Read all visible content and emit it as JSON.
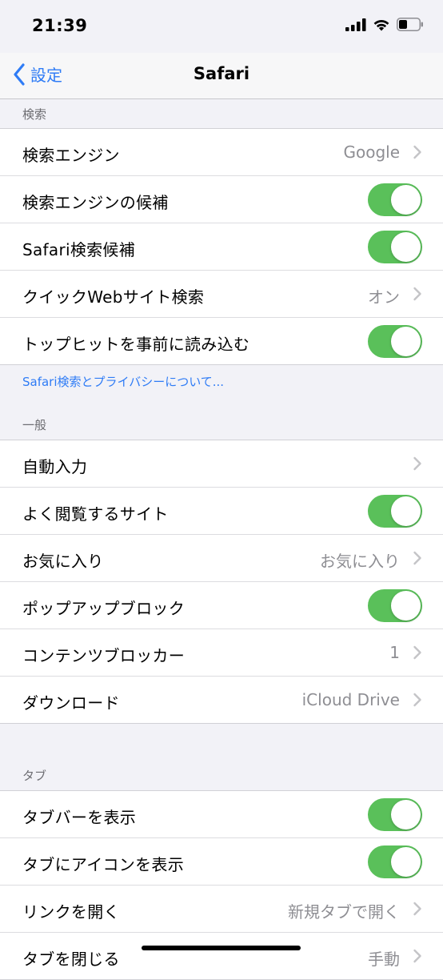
{
  "status_bar": {
    "time": "21:39",
    "battery_level": 0.4
  },
  "nav": {
    "back_label": "設定",
    "title": "Safari"
  },
  "search_section": {
    "header": "検索",
    "rows": [
      {
        "label": "検索エンジン",
        "value": "Google"
      },
      {
        "label": "検索エンジンの候補",
        "toggle": true
      },
      {
        "label": "Safari検索候補",
        "toggle": true
      },
      {
        "label": "クイックWebサイト検索",
        "value": "オン"
      },
      {
        "label": "トップヒットを事前に読み込む",
        "toggle": true
      }
    ],
    "footer_link": "Safari検索とプライバシーについて..."
  },
  "general_section": {
    "header": "一般",
    "rows": [
      {
        "label": "自動入力",
        "value": ""
      },
      {
        "label": "よく閲覧するサイト",
        "toggle": true
      },
      {
        "label": "お気に入り",
        "value": "お気に入り"
      },
      {
        "label": "ポップアップブロック",
        "toggle": true
      },
      {
        "label": "コンテンツブロッカー",
        "value": "1"
      },
      {
        "label": "ダウンロード",
        "value": "iCloud Drive"
      }
    ]
  },
  "tabs_section": {
    "header": "タブ",
    "rows": [
      {
        "label": "タブバーを表示",
        "toggle": true
      },
      {
        "label": "タブにアイコンを表示",
        "toggle": true
      },
      {
        "label": "リンクを開く",
        "value": "新規タブで開く"
      },
      {
        "label": "タブを閉じる",
        "value": "手動"
      }
    ]
  },
  "colors": {
    "accent": "#2f7cf6",
    "toggle_on": "#5ac05a",
    "background": "#f2f2f7"
  }
}
